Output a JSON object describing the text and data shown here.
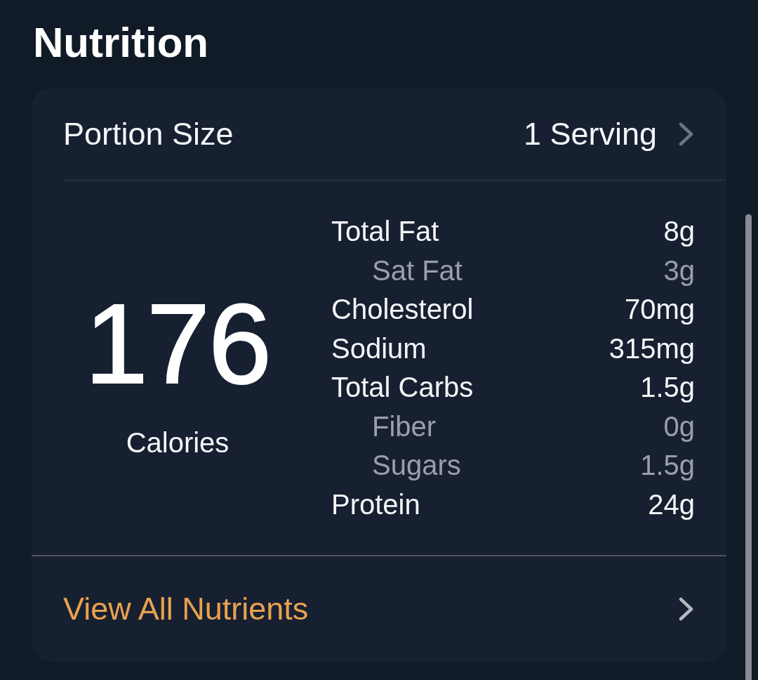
{
  "title": "Nutrition",
  "portion": {
    "label": "Portion Size",
    "value": "1 Serving"
  },
  "calories": {
    "value": "176",
    "label": "Calories"
  },
  "nutrients": [
    {
      "name": "Total Fat",
      "amount": "8g",
      "kind": "main"
    },
    {
      "name": "Sat Fat",
      "amount": "3g",
      "kind": "sub"
    },
    {
      "name": "Cholesterol",
      "amount": "70mg",
      "kind": "main"
    },
    {
      "name": "Sodium",
      "amount": "315mg",
      "kind": "main"
    },
    {
      "name": "Total Carbs",
      "amount": "1.5g",
      "kind": "main"
    },
    {
      "name": "Fiber",
      "amount": "0g",
      "kind": "sub"
    },
    {
      "name": "Sugars",
      "amount": "1.5g",
      "kind": "sub"
    },
    {
      "name": "Protein",
      "amount": "24g",
      "kind": "main"
    }
  ],
  "link": {
    "label": "View All Nutrients"
  }
}
